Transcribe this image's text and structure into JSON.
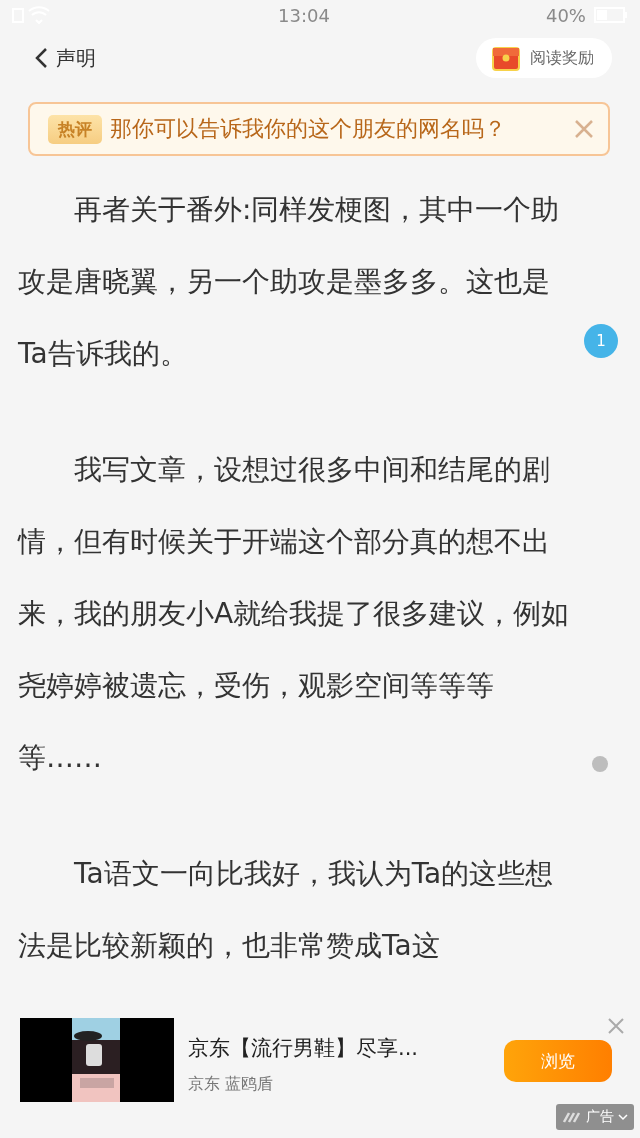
{
  "status_bar": {
    "time": "13:04",
    "battery": "40%"
  },
  "header": {
    "back_label": "声明",
    "reward_button": "阅读奖励"
  },
  "hot_comment": {
    "tag": "热评",
    "text": "那你可以告诉我你的这个朋友的网名吗？"
  },
  "paragraphs": [
    "再者关于番外:同样发梗图，其中一个助攻是唐晓翼，另一个助攻是墨多多。这也是Ta告诉我的。",
    "我写文章，设想过很多中间和结尾的剧情，但有时候关于开端这个部分真的想不出来，我的朋友小A就给我提了很多建议，例如尧婷婷被遗忘，受伤，观影空间等等等等……",
    "Ta语文一向比我好，我认为Ta的这些想法是比较新颖的，也非常赞成Ta这"
  ],
  "comment_badge": "1",
  "ad": {
    "title": "京东【流行男鞋】尽享...",
    "source": "京东 蓝鸥盾",
    "button": "浏览",
    "label": "广告"
  }
}
